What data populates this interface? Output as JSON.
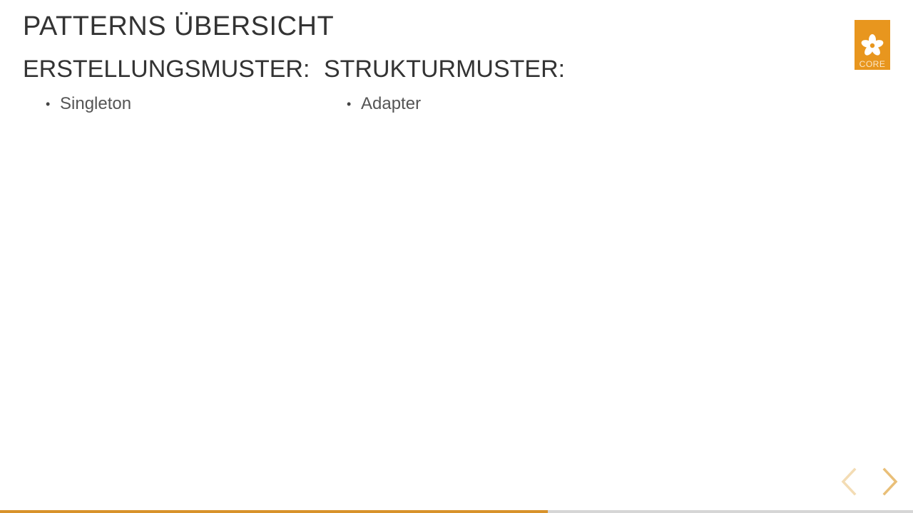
{
  "slide": {
    "title": "PATTERNS ÜBERSICHT",
    "columns": [
      {
        "heading": "ERSTELLUNGSMUSTER:",
        "items": [
          "Singleton"
        ]
      },
      {
        "heading": "STRUKTURMUSTER:",
        "items": [
          "Adapter"
        ]
      }
    ],
    "bullet": "•"
  },
  "logo": {
    "text": "CORE",
    "icon": "flower-icon",
    "color": "#e8961e"
  },
  "navigation": {
    "prev_icon": "chevron-left-icon",
    "next_icon": "chevron-right-icon",
    "prev_color": "#f3dcb4",
    "next_color": "#e9bf78"
  },
  "progress": {
    "fraction": 0.6,
    "fill_color": "#d8922b",
    "track_color": "#d6d6d6"
  }
}
